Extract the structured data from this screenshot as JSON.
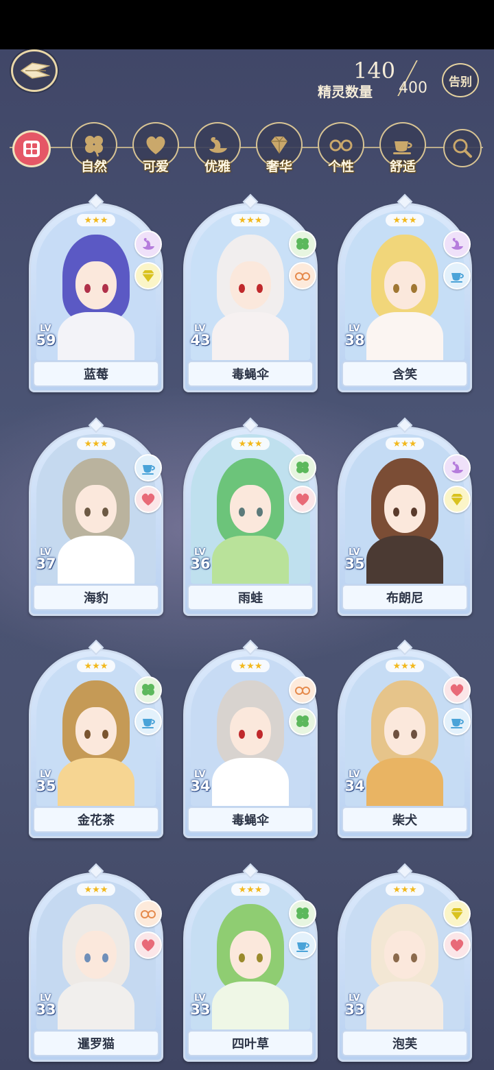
{
  "header": {
    "count_current": "140",
    "count_max": "400",
    "count_label": "精灵数量",
    "sort_label": "告别"
  },
  "filters": [
    {
      "label": "自然",
      "icon": "clover-icon"
    },
    {
      "label": "可爱",
      "icon": "heart-icon"
    },
    {
      "label": "优雅",
      "icon": "swan-icon"
    },
    {
      "label": "奢华",
      "icon": "diamond-icon"
    },
    {
      "label": "个性",
      "icon": "glasses-icon"
    },
    {
      "label": "舒适",
      "icon": "teacup-icon"
    }
  ],
  "colors": {
    "clover": "#5cb85c",
    "heart": "#e86a78",
    "swan": "#b57cdc",
    "gem": "#d9c21f",
    "glasses": "#e58a4c",
    "cup": "#4aa3d8",
    "star": "#f2b81c"
  },
  "cards": [
    {
      "name": "蓝莓",
      "level": "59",
      "stars": "★★★",
      "badges": [
        "swan",
        "gem"
      ]
    },
    {
      "name": "毒蝇伞",
      "level": "43",
      "stars": "★★★",
      "badges": [
        "clover",
        "glasses"
      ]
    },
    {
      "name": "含笑",
      "level": "38",
      "stars": "★★★",
      "badges": [
        "swan",
        "cup"
      ]
    },
    {
      "name": "海豹",
      "level": "37",
      "stars": "★★★",
      "badges": [
        "cup",
        "heart"
      ]
    },
    {
      "name": "雨蛙",
      "level": "36",
      "stars": "★★★",
      "badges": [
        "clover",
        "heart"
      ]
    },
    {
      "name": "布朗尼",
      "level": "35",
      "stars": "★★★",
      "badges": [
        "swan",
        "gem"
      ]
    },
    {
      "name": "金花茶",
      "level": "35",
      "stars": "★★★",
      "badges": [
        "clover",
        "cup"
      ]
    },
    {
      "name": "毒蝇伞",
      "level": "34",
      "stars": "★★★",
      "badges": [
        "glasses",
        "clover"
      ]
    },
    {
      "name": "柴犬",
      "level": "34",
      "stars": "★★★",
      "badges": [
        "heart",
        "cup"
      ]
    },
    {
      "name": "暹罗猫",
      "level": "33",
      "stars": "★★★",
      "badges": [
        "glasses",
        "heart"
      ]
    },
    {
      "name": "四叶草",
      "level": "33",
      "stars": "★★★",
      "badges": [
        "clover",
        "cup"
      ]
    },
    {
      "name": "泡芙",
      "level": "33",
      "stars": "★★★",
      "badges": [
        "gem",
        "heart"
      ]
    }
  ],
  "lv_label": "LV"
}
